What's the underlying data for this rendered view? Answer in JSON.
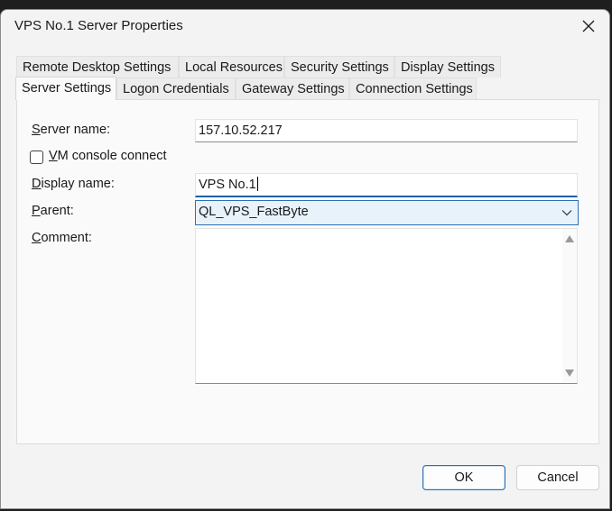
{
  "window": {
    "title": "VPS No.1 Server Properties"
  },
  "tabs": {
    "row1": [
      "Remote Desktop Settings",
      "Local Resources",
      "Security Settings",
      "Display Settings"
    ],
    "row2": [
      "Server Settings",
      "Logon Credentials",
      "Gateway Settings",
      "Connection Settings"
    ],
    "active": "Server Settings"
  },
  "form": {
    "server_name": {
      "label_mnemonic": "S",
      "label_rest": "erver name:",
      "value": "157.10.52.217"
    },
    "vm_console": {
      "label_mnemonic": "V",
      "label_rest": "M console connect",
      "checked": false
    },
    "display_name": {
      "label_mnemonic": "D",
      "label_rest": "isplay name:",
      "value": "VPS No.1"
    },
    "parent": {
      "label_mnemonic": "P",
      "label_rest": "arent:",
      "value": "QL_VPS_FastByte"
    },
    "comment": {
      "label_mnemonic": "C",
      "label_rest": "omment:",
      "value": ""
    }
  },
  "buttons": {
    "ok": "OK",
    "cancel": "Cancel"
  },
  "icons": {
    "close": "close-icon",
    "dropdown": "chevron-down-icon"
  },
  "colors": {
    "accent": "#2d6fb2",
    "dialog_bg": "#f3f3f3",
    "select_bg": "#e8f2fb"
  }
}
